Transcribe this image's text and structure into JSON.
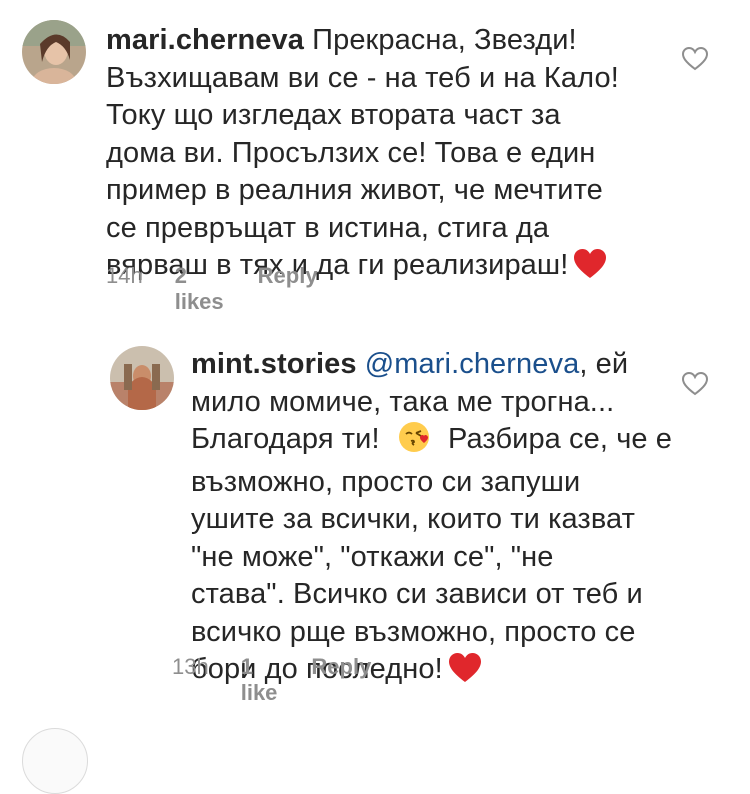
{
  "comments": [
    {
      "username": "mari.cherneva",
      "text_lines": [
        "Прекрасна, Звезди!",
        "Възхищавам ви се - на теб и на Кало!",
        "Току що изгледах втората част за",
        "дома ви. Просълзих се! Това е един",
        "пример в реалния живот, че мечтите",
        "се превръщат в истина, стига да",
        "вярваш в тях и да ги реализираш!"
      ],
      "emoji": "heart",
      "time": "14h",
      "likes": "2 likes",
      "reply": "Reply",
      "like_icon": "heart-outline-icon"
    },
    {
      "username": "mint.stories",
      "mention": "@mari.cherneva",
      "text_lines": [
        ", ей",
        "мило момиче, така ме трогна...",
        "Благодаря ти!",
        "Разбира се, че е",
        "възможно, просто си запуши",
        "ушите за всички, които ти казват",
        "\"не може\", \"откажи се\", \"не",
        "става\". Всичко си зависи от теб и",
        "всичко рще възможно, просто се",
        "бори до последно!"
      ],
      "emojis": [
        "kissing-face",
        "heart"
      ],
      "time": "13h",
      "likes": "1 like",
      "reply": "Reply",
      "like_icon": "heart-outline-icon"
    }
  ],
  "colors": {
    "text": "#262626",
    "meta": "#8e8e8e",
    "mention": "#1a4f8c",
    "heart": "#e0272c"
  }
}
